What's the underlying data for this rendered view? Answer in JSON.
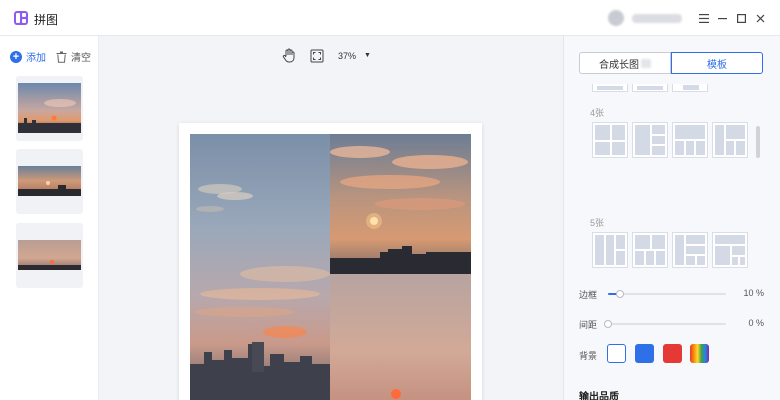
{
  "app": {
    "title": "拼图"
  },
  "sidebar": {
    "add_label": "添加",
    "clear_label": "清空"
  },
  "toolbar": {
    "zoom": "37%"
  },
  "right_panel": {
    "tabs": [
      {
        "label": "合成长图",
        "active": false
      },
      {
        "label": "模板",
        "active": true
      }
    ],
    "sections": [
      {
        "label": "4张"
      },
      {
        "label": "5张"
      }
    ],
    "sliders": [
      {
        "label": "边框",
        "value": 10,
        "unit": "%"
      },
      {
        "label": "间距",
        "value": 0,
        "unit": "%"
      }
    ],
    "background": {
      "label": "背景",
      "swatches": [
        "#ffffff",
        "#2f6fe8",
        "#e53935",
        "rainbow"
      ],
      "selected": 0
    },
    "output_quality_label": "输出品质"
  },
  "colors": {
    "accent": "#2f6fe8"
  }
}
